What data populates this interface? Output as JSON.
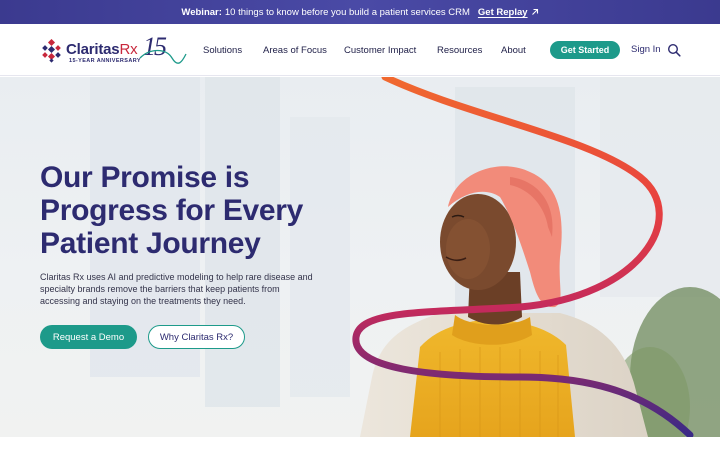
{
  "announcement": {
    "label": "Webinar:",
    "text": "10 things to know before you build a patient services CRM",
    "link": "Get Replay",
    "link_icon": "arrow-up-right-icon"
  },
  "header": {
    "logo_name": "Claritas",
    "logo_rx": "Rx",
    "logo_tagline": "15-YEAR ANNIVERSARY",
    "logo_number": "15",
    "nav": [
      "Solutions",
      "Areas of Focus",
      "Customer Impact",
      "Resources",
      "About"
    ],
    "cta": "Get Started",
    "signin": "Sign In",
    "search_icon": "search-icon"
  },
  "hero": {
    "title": "Our Promise is Progress for Every Patient Journey",
    "body": "Claritas Rx uses AI and predictive modeling to help rare disease and specialty brands remove the barriers that keep patients from accessing and staying on the treatments they need.",
    "primary_button": "Request a Demo",
    "secondary_button": "Why Claritas Rx?"
  },
  "colors": {
    "brand_navy": "#2d2b70",
    "accent_teal": "#1d9a8a",
    "accent_red": "#c8283c",
    "announcement_bg": "#3b3a8f",
    "ribbon_orange": "#f0692f",
    "ribbon_purple": "#3a2a86"
  }
}
